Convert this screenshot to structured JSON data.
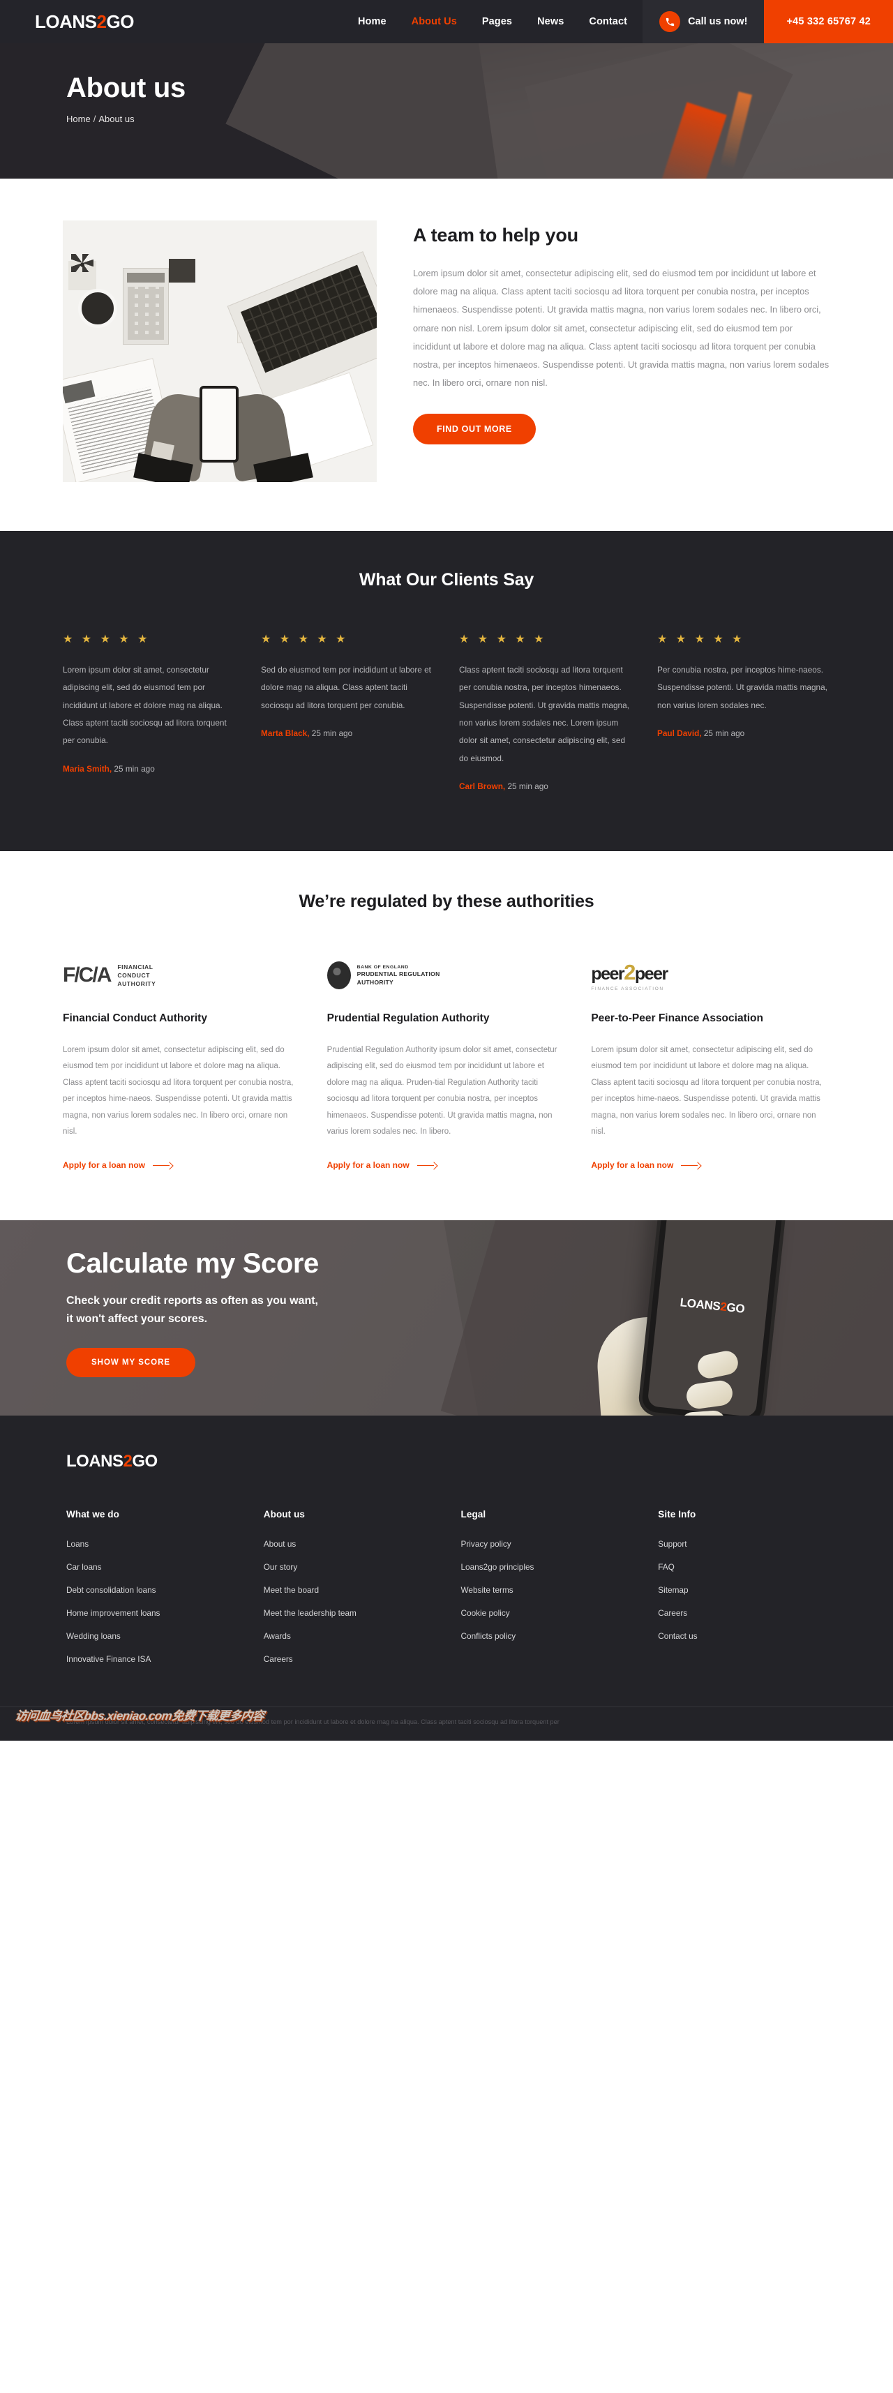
{
  "brand": {
    "name_main": "LOANS",
    "name_accent": "2",
    "name_tail": "GO"
  },
  "nav": {
    "items": [
      {
        "label": "Home",
        "active": false
      },
      {
        "label": "About Us",
        "active": true
      },
      {
        "label": "Pages",
        "active": false
      },
      {
        "label": "News",
        "active": false
      },
      {
        "label": "Contact",
        "active": false
      }
    ],
    "call_label": "Call us now!",
    "phone": "+45 332 65767 42"
  },
  "hero": {
    "title": "About us",
    "breadcrumb_home": "Home",
    "breadcrumb_sep": "/",
    "breadcrumb_current": "About us"
  },
  "team": {
    "title": "A team to help you",
    "body": "Lorem ipsum dolor sit amet, consectetur adipiscing elit, sed do eiusmod tem por incididunt ut labore et dolore mag na aliqua. Class aptent taciti sociosqu ad litora torquent per conubia nostra, per inceptos himenaeos. Suspendisse potenti. Ut gravida mattis magna, non varius lorem sodales nec. In libero orci, ornare non nisl. Lorem ipsum dolor sit amet, consectetur adipiscing elit, sed do eiusmod tem por incididunt ut labore et dolore mag na aliqua. Class aptent taciti sociosqu ad litora torquent per conubia nostra, per inceptos himenaeos. Suspendisse potenti. Ut gravida mattis magna, non varius lorem sodales nec. In libero orci, ornare non nisl.",
    "button": "FIND OUT MORE"
  },
  "testimonials": {
    "title": "What Our Clients Say",
    "stars": "★ ★ ★ ★ ★",
    "items": [
      {
        "text": "Lorem ipsum dolor sit amet, consectetur adipiscing elit, sed do eiusmod tem por incididunt ut labore et dolore mag na aliqua. Class aptent taciti sociosqu ad litora torquent per conubia.",
        "author": "Maria Smith,",
        "time": " 25 min ago"
      },
      {
        "text": "Sed do eiusmod tem por incididunt ut labore et dolore mag na aliqua. Class aptent taciti sociosqu ad litora torquent per conubia.",
        "author": "Marta Black,",
        "time": " 25 min ago"
      },
      {
        "text": "Class aptent taciti sociosqu ad litora torquent per conubia nostra, per inceptos himenaeos. Suspendisse potenti. Ut gravida mattis magna, non varius lorem sodales nec. Lorem ipsum dolor sit amet, consectetur adipiscing elit, sed do eiusmod.",
        "author": "Carl Brown,",
        "time": " 25 min ago"
      },
      {
        "text": "Per conubia nostra, per inceptos hime-naeos. Suspendisse potenti. Ut gravida mattis magna, non varius lorem sodales nec.",
        "author": "Paul David,",
        "time": " 25 min ago"
      }
    ]
  },
  "authorities": {
    "title": "We’re regulated by these authorities",
    "cards": [
      {
        "logo_type": "fca-logo",
        "logo_words": "FINANCIAL\nCONDUCT\nAUTHORITY",
        "title": "Financial Conduct Authority",
        "text": "Lorem ipsum dolor sit amet, consectetur adipiscing elit, sed do eiusmod tem por incididunt ut labore et dolore mag na aliqua. Class aptent taciti sociosqu ad litora torquent per conubia nostra, per inceptos hime-naeos. Suspendisse potenti. Ut gravida mattis magna, non varius lorem sodales nec. In libero orci, ornare non nisl.",
        "link": "Apply for a loan now"
      },
      {
        "logo_type": "bank-of-england-seal-logo",
        "logo_small": "BANK OF ENGLAND",
        "logo_big1": "PRUDENTIAL REGULATION",
        "logo_big2": "AUTHORITY",
        "title": "Prudential Regulation Authority",
        "text": "Prudential Regulation Authority ipsum dolor sit amet, consectetur adipiscing elit, sed do eiusmod tem por incididunt ut labore et dolore mag na aliqua. Pruden-tial Regulation Authority taciti sociosqu ad litora torquent per conubia nostra, per inceptos himenaeos. Suspendisse potenti. Ut gravida mattis magna, non varius lorem sodales nec. In libero.",
        "link": "Apply for a loan now"
      },
      {
        "logo_type": "peer2peer-logo",
        "logo_mark_a": "peer",
        "logo_mark_two": "2",
        "logo_mark_b": "peer",
        "logo_sub": "FINANCE ASSOCIATION",
        "title": "Peer-to-Peer Finance Association",
        "text": "Lorem ipsum dolor sit amet, consectetur adipiscing elit, sed do eiusmod tem por incididunt ut labore et dolore mag na aliqua. Class aptent taciti sociosqu ad litora torquent per conubia nostra, per inceptos hime-naeos. Suspendisse potenti. Ut gravida mattis magna, non varius lorem sodales nec. In libero orci, ornare non nisl.",
        "link": "Apply for a loan now"
      }
    ]
  },
  "cta": {
    "title": "Calculate my Score",
    "subtitle_line1": "Check your credit reports as often as you want,",
    "subtitle_line2": "it won't affect your scores.",
    "button": "SHOW MY SCORE",
    "phone_screen_main": "LOANS",
    "phone_screen_accent": "2",
    "phone_screen_tail": "GO"
  },
  "footer": {
    "columns": [
      {
        "heading": "What we do",
        "links": [
          "Loans",
          "Car loans",
          "Debt consolidation loans",
          "Home improvement loans",
          "Wedding loans",
          "Innovative Finance ISA"
        ]
      },
      {
        "heading": "About us",
        "links": [
          "About us",
          "Our story",
          "Meet the board",
          "Meet the leadership team",
          "Awards",
          "Careers"
        ]
      },
      {
        "heading": "Legal",
        "links": [
          "Privacy policy",
          "Loans2go principles",
          "Website terms",
          "Cookie policy",
          "Conflicts policy"
        ]
      },
      {
        "heading": "Site Info",
        "links": [
          "Support",
          "FAQ",
          "Sitemap",
          "Careers",
          "Contact us"
        ]
      }
    ],
    "disclaimer": "Lorem ipsum dolor sit amet, consectetur adipiscing elit, sed do eiusmod tem por incididunt ut labore et dolore mag na aliqua. Class aptent taciti sociosqu ad litora torquent per",
    "watermark": "访问血鸟社区bbs.xieniao.com免费下载更多内容"
  },
  "colors": {
    "accent": "#f04000",
    "dark": "#232328",
    "star": "#e3b53f",
    "muted": "#8b8b8e"
  }
}
